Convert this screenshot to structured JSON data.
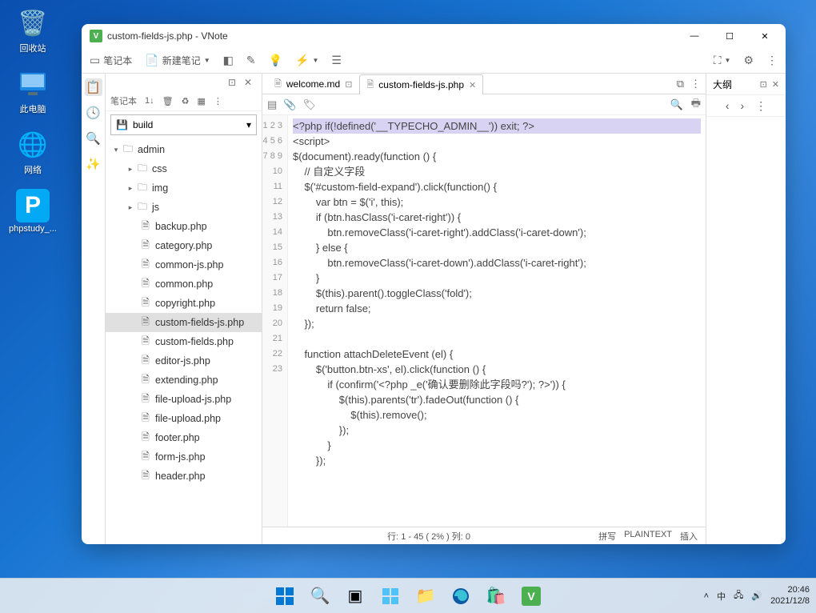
{
  "desktop": {
    "items": [
      {
        "label": "回收站",
        "icon": "🗑️"
      },
      {
        "label": "此电脑",
        "icon": "💻"
      },
      {
        "label": "网络",
        "icon": "🌐"
      },
      {
        "label": "phpstudy_...",
        "icon": "P"
      }
    ]
  },
  "window": {
    "title": "custom-fields-js.php - VNote",
    "toolbar": {
      "notebook": "笔记本",
      "new_note": "新建笔记"
    },
    "notes_pane": {
      "title": "笔记本",
      "select": "build",
      "tree_folders": [
        {
          "name": "admin",
          "depth": 0,
          "expanded": true
        },
        {
          "name": "css",
          "depth": 1
        },
        {
          "name": "img",
          "depth": 1
        },
        {
          "name": "js",
          "depth": 1
        }
      ],
      "tree_files": [
        "backup.php",
        "category.php",
        "common-js.php",
        "common.php",
        "copyright.php",
        "custom-fields-js.php",
        "custom-fields.php",
        "editor-js.php",
        "extending.php",
        "file-upload-js.php",
        "file-upload.php",
        "footer.php",
        "form-js.php",
        "header.php"
      ],
      "selected": "custom-fields-js.php"
    },
    "tabs": [
      {
        "label": "welcome.md",
        "active": false
      },
      {
        "label": "custom-fields-js.php",
        "active": true
      }
    ],
    "outline": {
      "title": "大纲"
    },
    "editor": {
      "lines": [
        "<?php if(!defined('__TYPECHO_ADMIN__')) exit; ?>",
        "<script>",
        "$(document).ready(function () {",
        "    // 自定义字段",
        "    $('#custom-field-expand').click(function() {",
        "        var btn = $('i', this);",
        "        if (btn.hasClass('i-caret-right')) {",
        "            btn.removeClass('i-caret-right').addClass('i-caret-down');",
        "        } else {",
        "            btn.removeClass('i-caret-down').addClass('i-caret-right');",
        "        }",
        "        $(this).parent().toggleClass('fold');",
        "        return false;",
        "    });",
        "",
        "    function attachDeleteEvent (el) {",
        "        $('button.btn-xs', el).click(function () {",
        "            if (confirm('<?php _e('确认要删除此字段吗?'); ?>')) {",
        "                $(this).parents('tr').fadeOut(function () {",
        "                    $(this).remove();",
        "                });",
        "            }",
        "        });"
      ],
      "line_numbers": [
        1,
        2,
        3,
        4,
        5,
        6,
        7,
        8,
        9,
        10,
        11,
        12,
        13,
        14,
        15,
        16,
        17,
        18,
        19,
        20,
        21,
        22,
        23
      ]
    },
    "status": {
      "pos": "行: 1 - 45 ( 2% )   列: 0",
      "ime": "拼写",
      "lang": "PLAINTEXT",
      "mode": "插入"
    }
  },
  "taskbar": {
    "ime": "中",
    "time": "20:46",
    "date": "2021/12/8"
  }
}
